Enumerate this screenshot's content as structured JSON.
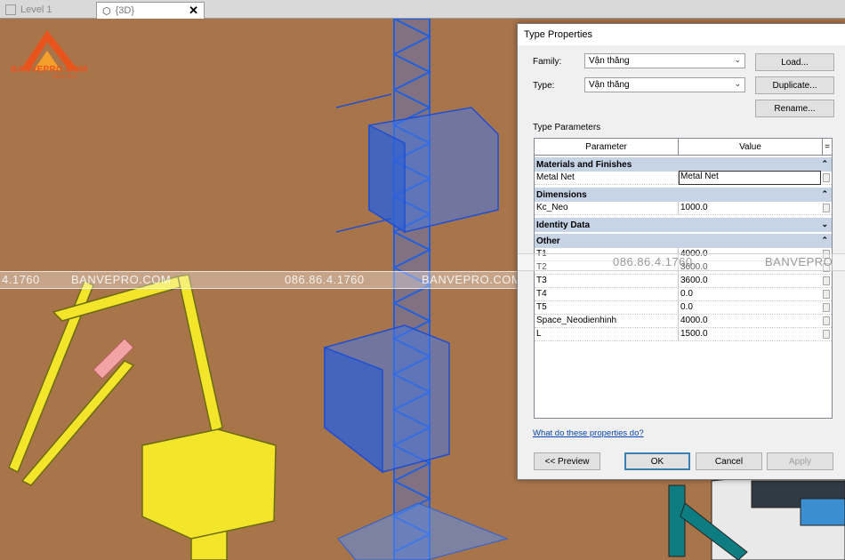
{
  "tabs": [
    {
      "label": "Level 1"
    },
    {
      "label": "{3D}"
    }
  ],
  "watermark": {
    "brand": "BANVEPRO.COM",
    "brand_sub": "SINCE 2014",
    "phone": "086.86.4.1760",
    "phone_partial": "4.1760",
    "site": "BANVEPRO.COM",
    "site_partial": "BANVEPRO"
  },
  "dialog": {
    "title": "Type Properties",
    "family_label": "Family:",
    "family_value": "Vận thăng",
    "type_label": "Type:",
    "type_value": "Vận thăng",
    "load_btn": "Load...",
    "duplicate_btn": "Duplicate...",
    "rename_btn": "Rename...",
    "type_params_label": "Type Parameters",
    "col_param": "Parameter",
    "col_value": "Value",
    "col_eq": "=",
    "groups": [
      {
        "name": "Materials and Finishes",
        "rows": [
          {
            "param": "Metal Net",
            "value": "Metal Net"
          }
        ]
      },
      {
        "name": "Dimensions",
        "rows": [
          {
            "param": "Kc_Neo",
            "value": "1000.0"
          }
        ]
      },
      {
        "name": "Identity Data",
        "rows": []
      },
      {
        "name": "Other",
        "rows": [
          {
            "param": "T1",
            "value": "4000.0"
          },
          {
            "param": "T2",
            "value": "3600.0"
          },
          {
            "param": "T3",
            "value": "3600.0"
          },
          {
            "param": "T4",
            "value": "0.0"
          },
          {
            "param": "T5",
            "value": "0.0"
          },
          {
            "param": "Space_Neodienhinh",
            "value": "4000.0"
          },
          {
            "param": "L",
            "value": "1500.0"
          }
        ]
      }
    ],
    "help_link": "What do these properties do?",
    "preview_btn": "<< Preview",
    "ok_btn": "OK",
    "cancel_btn": "Cancel",
    "apply_btn": "Apply"
  }
}
